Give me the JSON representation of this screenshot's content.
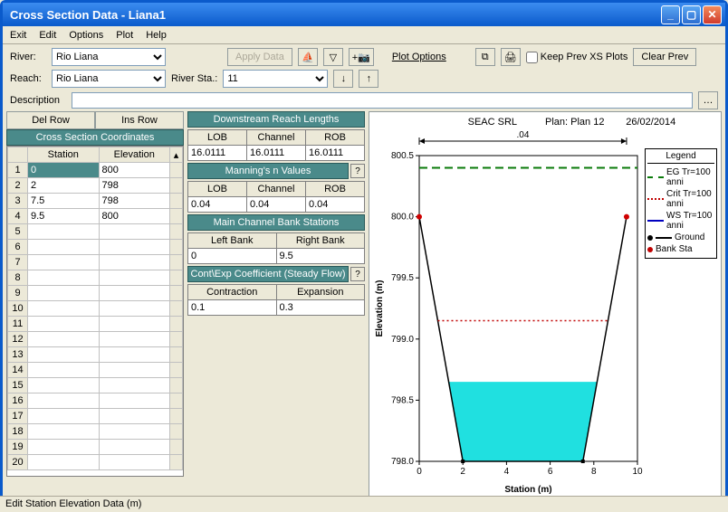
{
  "window_title": "Cross Section Data - Liana1",
  "menus": [
    "Exit",
    "Edit",
    "Options",
    "Plot",
    "Help"
  ],
  "labels": {
    "river": "River:",
    "reach": "Reach:",
    "river_sta": "River Sta.:",
    "description": "Description",
    "del_row": "Del Row",
    "ins_row": "Ins Row",
    "apply_data": "Apply Data",
    "plot_options": "Plot Options",
    "keep_prev": "Keep Prev XS Plots",
    "clear_prev": "Clear Prev"
  },
  "dropdowns": {
    "river": "Rio Liana",
    "reach": "Rio Liana",
    "river_sta": "11"
  },
  "description_value": "",
  "coord": {
    "title": "Cross Section Coordinates",
    "col1": "Station",
    "col2": "Elevation",
    "rows": [
      {
        "station": "0",
        "elevation": "800"
      },
      {
        "station": "2",
        "elevation": "798"
      },
      {
        "station": "7.5",
        "elevation": "798"
      },
      {
        "station": "9.5",
        "elevation": "800"
      }
    ],
    "numrows": 20
  },
  "downstream": {
    "title": "Downstream Reach Lengths",
    "cols": [
      "LOB",
      "Channel",
      "ROB"
    ],
    "vals": [
      "16.0111",
      "16.0111",
      "16.0111"
    ]
  },
  "manning": {
    "title": "Manning's n Values",
    "cols": [
      "LOB",
      "Channel",
      "ROB"
    ],
    "vals": [
      "0.04",
      "0.04",
      "0.04"
    ]
  },
  "bank": {
    "title": "Main Channel Bank Stations",
    "cols": [
      "Left Bank",
      "Right Bank"
    ],
    "vals": [
      "0",
      "9.5"
    ]
  },
  "coeff": {
    "title": "Cont\\Exp Coefficient (Steady Flow)",
    "cols": [
      "Contraction",
      "Expansion"
    ],
    "vals": [
      "0.1",
      "0.3"
    ]
  },
  "statusbar": "Edit Station Elevation Data (m)",
  "chart": {
    "header_center": "SEAC SRL",
    "header_plan": "Plan: Plan 12",
    "header_date": "26/02/2014",
    "dim_label": ".04",
    "xlabel": "Station (m)",
    "ylabel": "Elevation (m)"
  },
  "legend": {
    "title": "Legend",
    "items": [
      {
        "label": "EG Tr=100 anni",
        "type": "dashed",
        "color": "#0a7a0a"
      },
      {
        "label": "Crit Tr=100 anni",
        "type": "dotted",
        "color": "#c00000"
      },
      {
        "label": "WS Tr=100 anni",
        "type": "solid",
        "color": "#0000c0"
      },
      {
        "label": "Ground",
        "type": "line-mark",
        "color": "#000000"
      },
      {
        "label": "Bank Sta",
        "type": "mark",
        "color": "#c00000"
      }
    ]
  },
  "chart_data": {
    "type": "line",
    "title": "SEAC SRL    Plan: Plan 12    26/02/2014",
    "xlabel": "Station (m)",
    "ylabel": "Elevation (m)",
    "xlim": [
      0,
      10
    ],
    "ylim": [
      798.0,
      800.5
    ],
    "xticks": [
      0,
      2,
      4,
      6,
      8,
      10
    ],
    "yticks": [
      798.0,
      798.5,
      799.0,
      799.5,
      800.0,
      800.5
    ],
    "series": [
      {
        "name": "Ground",
        "x": [
          0,
          2,
          7.5,
          9.5
        ],
        "y": [
          800,
          798,
          798,
          800
        ],
        "color": "#000000"
      },
      {
        "name": "EG Tr=100 anni",
        "y_const": 800.4,
        "color": "#0a7a0a",
        "style": "dashed"
      },
      {
        "name": "Crit Tr=100 anni",
        "y_const": 799.15,
        "color": "#c00000",
        "style": "dotted"
      },
      {
        "name": "WS Tr=100 anni",
        "y_const": 798.65,
        "color": "#0000c0",
        "style": "solid",
        "fill_below_to_ground": true,
        "fill_color": "#00e0e0"
      }
    ],
    "bank_stations": [
      {
        "x": 0,
        "y": 800
      },
      {
        "x": 9.5,
        "y": 800
      }
    ],
    "annotation": {
      "text": ".04",
      "from_x": 0,
      "to_x": 9.5,
      "y": 800.35
    }
  }
}
